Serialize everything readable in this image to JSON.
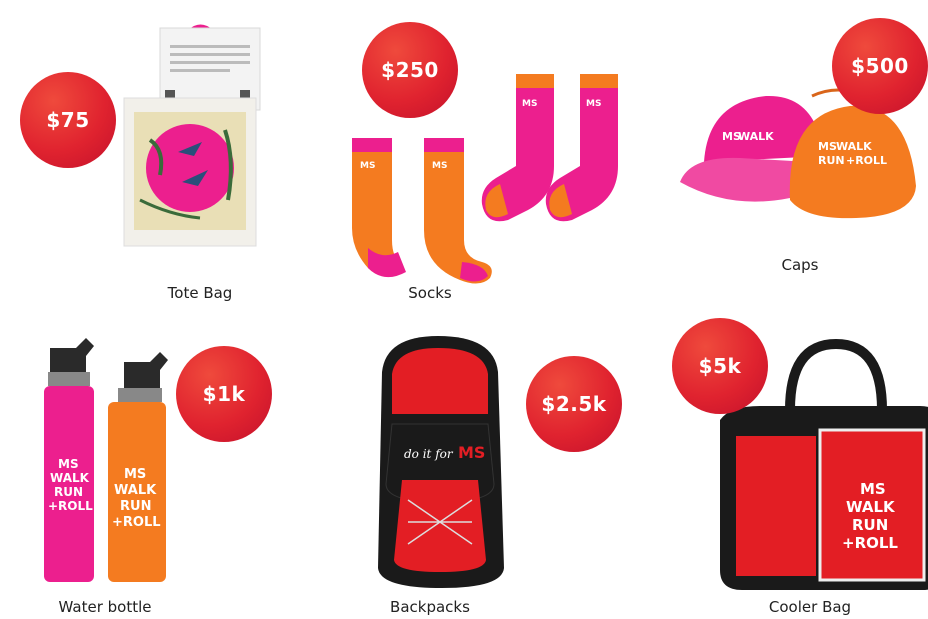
{
  "items": [
    {
      "price": "$75",
      "label": "Tote Bag"
    },
    {
      "price": "$250",
      "label": "Socks"
    },
    {
      "price": "$500",
      "label": "Caps"
    },
    {
      "price": "$1k",
      "label": "Water bottle"
    },
    {
      "price": "$2.5k",
      "label": "Backpacks"
    },
    {
      "price": "$5k",
      "label": "Cooler Bag"
    }
  ],
  "brand": {
    "ms": "MS",
    "walk": "WALK",
    "run": "RUN",
    "roll": "+ROLL",
    "do_it_for": "do it for"
  },
  "colors": {
    "badge": "#e0232f",
    "pink": "#ec1f8e",
    "orange": "#f47b20",
    "red": "#e31e24",
    "black": "#1a1a1a"
  }
}
